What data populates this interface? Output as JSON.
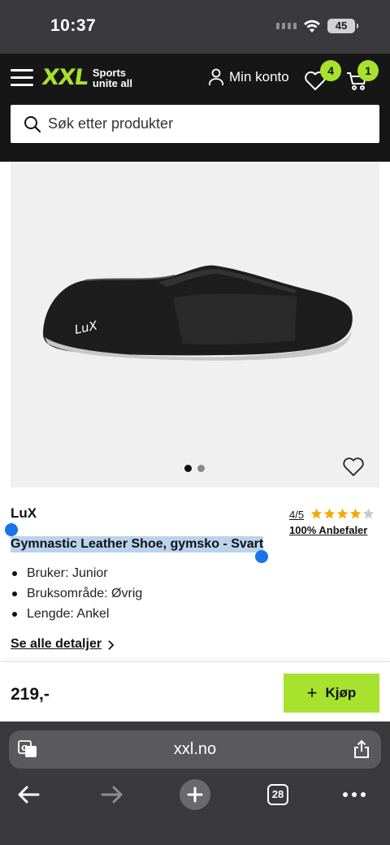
{
  "status_bar": {
    "time": "10:37",
    "battery": "45"
  },
  "header": {
    "logo_mark": "XXL",
    "logo_tagline_1": "Sports",
    "logo_tagline_2": "unite all",
    "account_label": "Min konto",
    "wishlist_count": "4",
    "cart_count": "1",
    "search_placeholder": "Søk etter produkter"
  },
  "product": {
    "brand": "LuX",
    "rating": "4/5",
    "stars_filled": 4,
    "stars_total": 5,
    "recommend": "100% Anbefaler",
    "title": "Gymnastic Leather Shoe, gymsko - Svart",
    "specs": [
      "Bruker: Junior",
      "Bruksområde: Øvrig",
      "Lengde: Ankel"
    ],
    "details_link": "Se alle detaljer",
    "image_count": 2,
    "active_image": 1,
    "shoe_logo": "LuX"
  },
  "buy_bar": {
    "price": "219,-",
    "buy_label": "Kjøp"
  },
  "browser": {
    "url": "xxl.no",
    "tab_count": "28"
  },
  "colors": {
    "accent": "#a6e22e",
    "header_bg": "#161616",
    "selection": "#b9d3ee",
    "handle": "#1a73e8"
  }
}
